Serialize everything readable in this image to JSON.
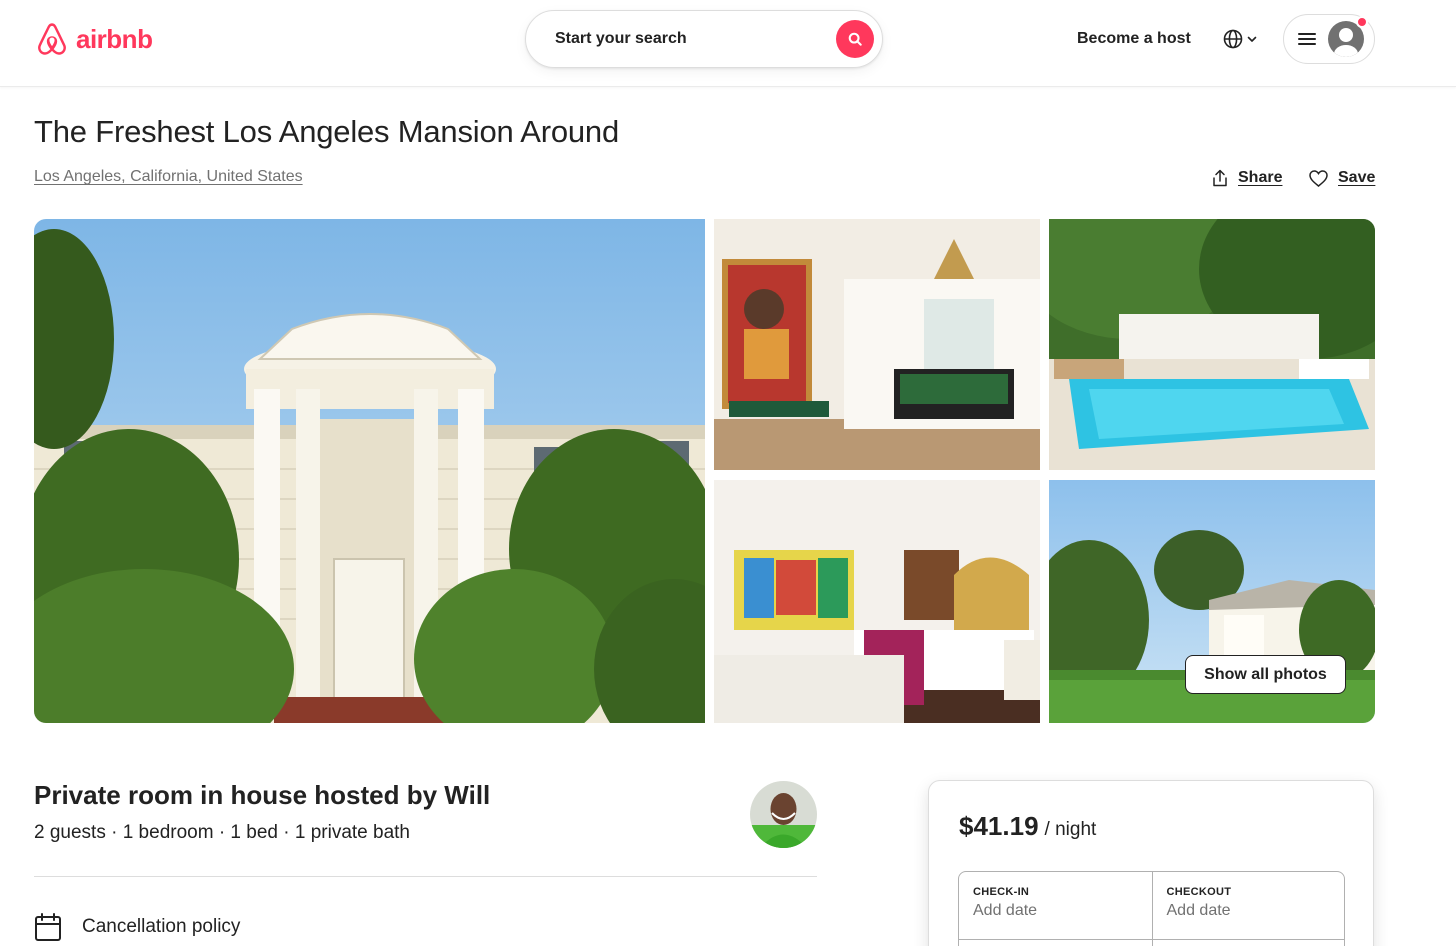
{
  "header": {
    "logo_text": "airbnb",
    "search_placeholder": "Start your search",
    "become_host_label": "Become a host",
    "language_icon": "globe-icon",
    "menu_icon": "hamburger-icon",
    "brand_color": "#ff385c"
  },
  "listing": {
    "title": "The Freshest Los Angeles Mansion Around",
    "location": "Los Angeles, California, United States",
    "share_label": "Share",
    "save_label": "Save"
  },
  "gallery": {
    "show_all_label": "Show all photos",
    "photos": [
      "mansion-front-photo",
      "game-room-photo",
      "pool-photo",
      "bedroom-photo",
      "mansion-exterior-photo"
    ]
  },
  "details": {
    "room_title": "Private room in house hosted by Will",
    "room_meta": "2 guests · 1 bedroom · 1 bed · 1 private bath",
    "cancellation_label": "Cancellation policy"
  },
  "booking": {
    "price": "$41.19",
    "price_unit": "/ night",
    "checkin_label": "CHECK-IN",
    "checkin_value": "Add date",
    "checkout_label": "CHECKOUT",
    "checkout_value": "Add date"
  }
}
